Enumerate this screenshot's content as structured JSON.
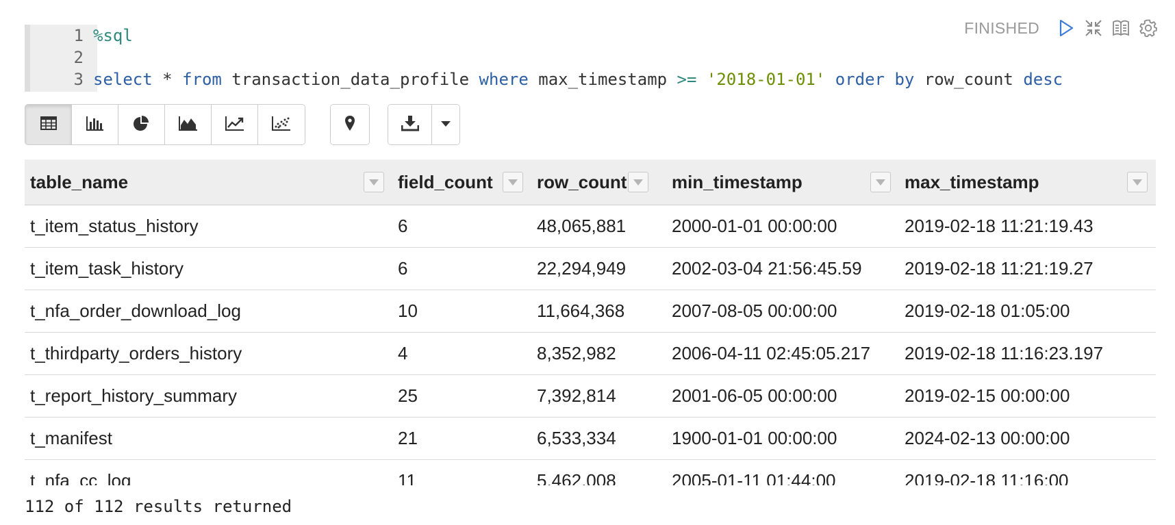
{
  "editor": {
    "lines": [
      {
        "num": "1",
        "tokens": [
          {
            "text": "%sql",
            "cls": "tok-interp"
          }
        ]
      },
      {
        "num": "2",
        "tokens": []
      },
      {
        "num": "3",
        "tokens": [
          {
            "text": "select",
            "cls": "tok-kw"
          },
          {
            "text": " * ",
            "cls": "tok-plain"
          },
          {
            "text": "from",
            "cls": "tok-kw"
          },
          {
            "text": " transaction_data_profile ",
            "cls": "tok-plain"
          },
          {
            "text": "where",
            "cls": "tok-kw"
          },
          {
            "text": " max_timestamp ",
            "cls": "tok-plain"
          },
          {
            "text": ">=",
            "cls": "tok-op"
          },
          {
            "text": " ",
            "cls": "tok-plain"
          },
          {
            "text": "'2018-01-01'",
            "cls": "tok-str"
          },
          {
            "text": " ",
            "cls": "tok-plain"
          },
          {
            "text": "order",
            "cls": "tok-kw"
          },
          {
            "text": " ",
            "cls": "tok-plain"
          },
          {
            "text": "by",
            "cls": "tok-kw"
          },
          {
            "text": " row_count ",
            "cls": "tok-plain"
          },
          {
            "text": "desc",
            "cls": "tok-kw"
          }
        ]
      }
    ]
  },
  "paragraph": {
    "status": "FINISHED",
    "icons": [
      "run-icon",
      "collapse-icon",
      "book-icon",
      "gear-icon"
    ]
  },
  "toolbar": {
    "viz_buttons": [
      {
        "icon": "table-icon",
        "active": true
      },
      {
        "icon": "bar-chart-icon",
        "active": false
      },
      {
        "icon": "pie-chart-icon",
        "active": false
      },
      {
        "icon": "area-chart-icon",
        "active": false
      },
      {
        "icon": "line-chart-icon",
        "active": false
      },
      {
        "icon": "scatter-chart-icon",
        "active": false
      }
    ],
    "map_button": {
      "icon": "map-pin-icon"
    },
    "download": {
      "icon": "download-icon",
      "dropdown_icon": "caret-down-icon"
    }
  },
  "table": {
    "columns": [
      "table_name",
      "field_count",
      "row_count",
      "min_timestamp",
      "max_timestamp"
    ],
    "rows": [
      [
        "t_item_status_history",
        "6",
        "48,065,881",
        "2000-01-01 00:00:00",
        "2019-02-18 11:21:19.43"
      ],
      [
        "t_item_task_history",
        "6",
        "22,294,949",
        "2002-03-04 21:56:45.59",
        "2019-02-18 11:21:19.27"
      ],
      [
        "t_nfa_order_download_log",
        "10",
        "11,664,368",
        "2007-08-05 00:00:00",
        "2019-02-18 01:05:00"
      ],
      [
        "t_thirdparty_orders_history",
        "4",
        "8,352,982",
        "2006-04-11 02:45:05.217",
        "2019-02-18 11:16:23.197"
      ],
      [
        "t_report_history_summary",
        "25",
        "7,392,814",
        "2001-06-05 00:00:00",
        "2019-02-15 00:00:00"
      ],
      [
        "t_manifest",
        "21",
        "6,533,334",
        "1900-01-01 00:00:00",
        "2024-02-13 00:00:00"
      ],
      [
        "t_nfa_cc_log",
        "11",
        "5,462,008",
        "2005-01-11 01:44:00",
        "2019-02-18 11:16:00"
      ]
    ]
  },
  "footer": {
    "result_text": "112 of 112 results returned"
  }
}
